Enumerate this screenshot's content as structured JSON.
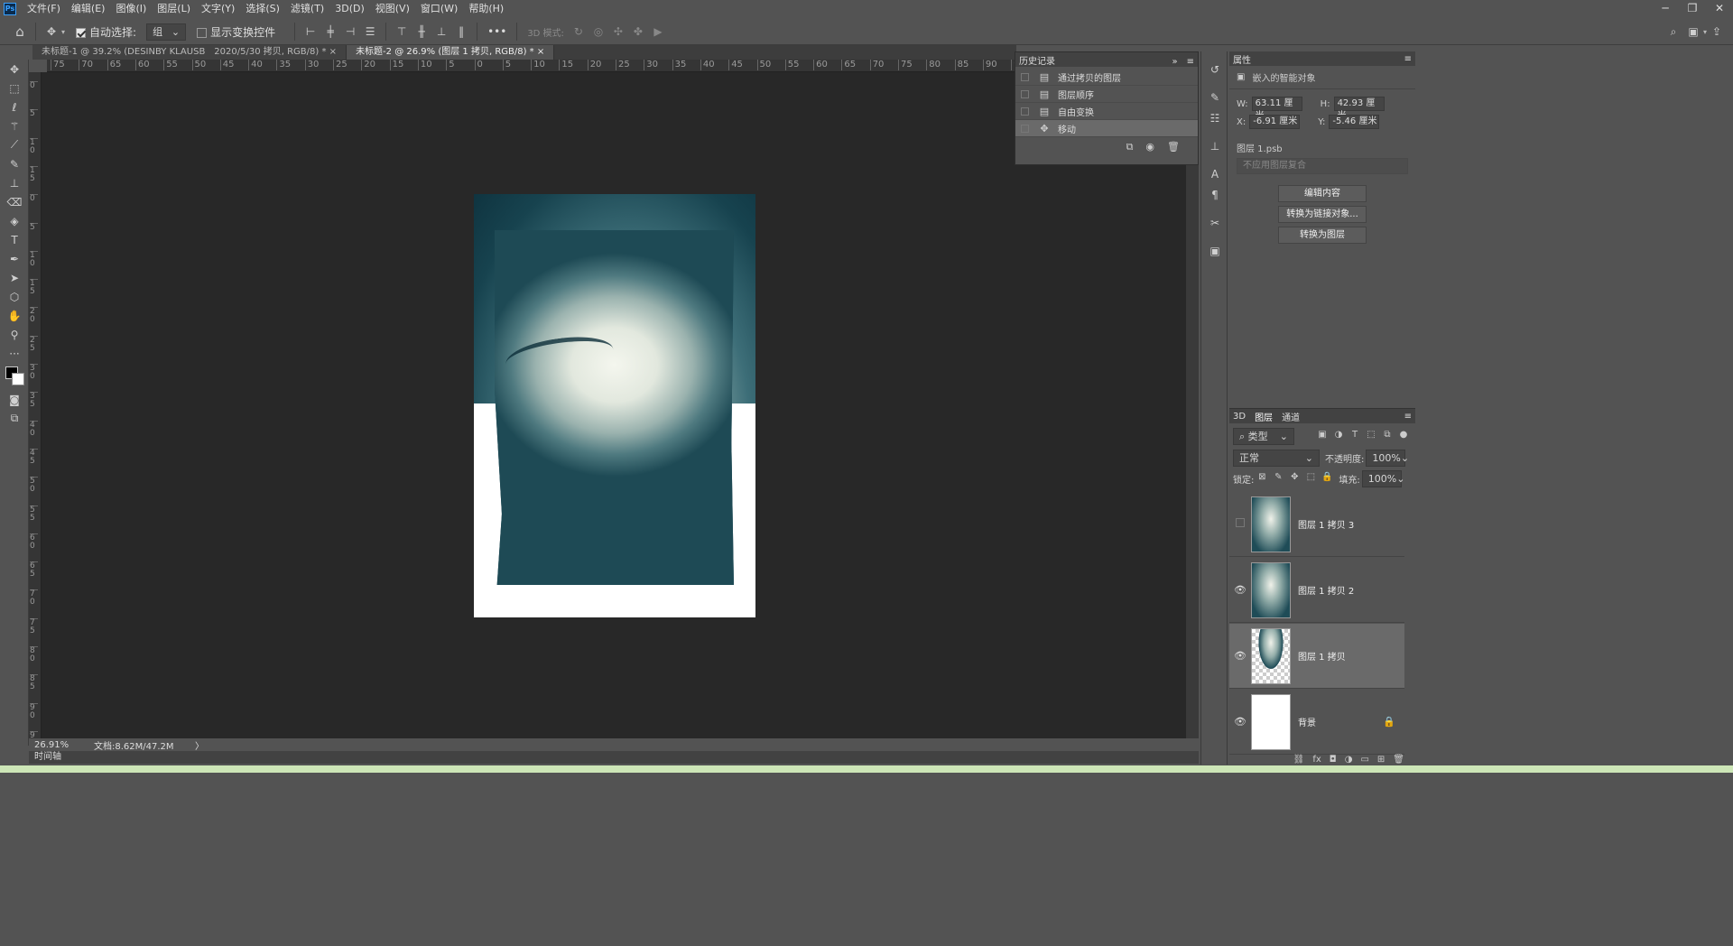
{
  "menu": [
    "文件(F)",
    "编辑(E)",
    "图像(I)",
    "图层(L)",
    "文字(Y)",
    "选择(S)",
    "滤镜(T)",
    "3D(D)",
    "视图(V)",
    "窗口(W)",
    "帮助(H)"
  ],
  "app_icon": "Ps",
  "options": {
    "auto_select_label": "自动选择:",
    "auto_select_value": "组",
    "show_transform_label": "显示变换控件",
    "mode_3d": "3D 模式:",
    "more": "•••"
  },
  "tabs": [
    {
      "label": "未标题-1 @ 39.2% (DESINBY KLAUSB　2020/5/30 拷贝, RGB/8) *",
      "close": "×"
    },
    {
      "label": "未标题-2 @ 26.9% (图层 1 拷贝, RGB/8) *",
      "close": "×"
    }
  ],
  "ruler_top": [
    "75",
    "70",
    "65",
    "60",
    "55",
    "50",
    "45",
    "40",
    "35",
    "30",
    "25",
    "20",
    "15",
    "10",
    "5",
    "0",
    "5",
    "10",
    "15",
    "20",
    "25",
    "30",
    "35",
    "40",
    "45",
    "50",
    "55",
    "60",
    "65",
    "70",
    "75",
    "80",
    "85",
    "90",
    "9"
  ],
  "ruler_left": [
    "0",
    "5",
    "10",
    "15",
    "0",
    "5",
    "10",
    "15",
    "20",
    "25",
    "30",
    "35",
    "40",
    "45",
    "50",
    "55",
    "60",
    "65",
    "70",
    "75",
    "80",
    "85",
    "90",
    "9"
  ],
  "status": {
    "zoom": "26.91%",
    "doc": "文档:8.62M/47.2M",
    "arrow": "〉"
  },
  "timeline_label": "时间轴",
  "history": {
    "title": "历史记录",
    "items": [
      "通过拷贝的图层",
      "图层顺序",
      "自由变换",
      "移动"
    ]
  },
  "properties": {
    "title": "属性",
    "type": "嵌入的智能对象",
    "w_label": "W:",
    "w": "63.11 厘米",
    "h_label": "H:",
    "h": "42.93 厘米",
    "x_label": "X:",
    "x": "-6.91 厘米",
    "y_label": "Y:",
    "y": "-5.46 厘米",
    "file": "图层 1.psb",
    "comp": "不应用图层复合",
    "btn_edit": "编辑内容",
    "btn_convert_linked": "转换为链接对象...",
    "btn_convert_layers": "转换为图层"
  },
  "layers": {
    "tabs": [
      "3D",
      "图层",
      "通道"
    ],
    "filter": "类型",
    "blend": "正常",
    "opacity_label": "不透明度:",
    "opacity": "100%",
    "lock_label": "锁定:",
    "fill_label": "填充:",
    "fill": "100%",
    "items": [
      {
        "name": "图层 1 拷贝 3",
        "visible": false
      },
      {
        "name": "图层 1 拷贝 2",
        "visible": true
      },
      {
        "name": "图层 1 拷贝",
        "visible": true
      },
      {
        "name": "背景",
        "visible": true
      }
    ],
    "footer_fx": "fx"
  },
  "colors": {
    "accent": "#3aa0ff",
    "panel": "#535353",
    "canvas": "#282828"
  }
}
